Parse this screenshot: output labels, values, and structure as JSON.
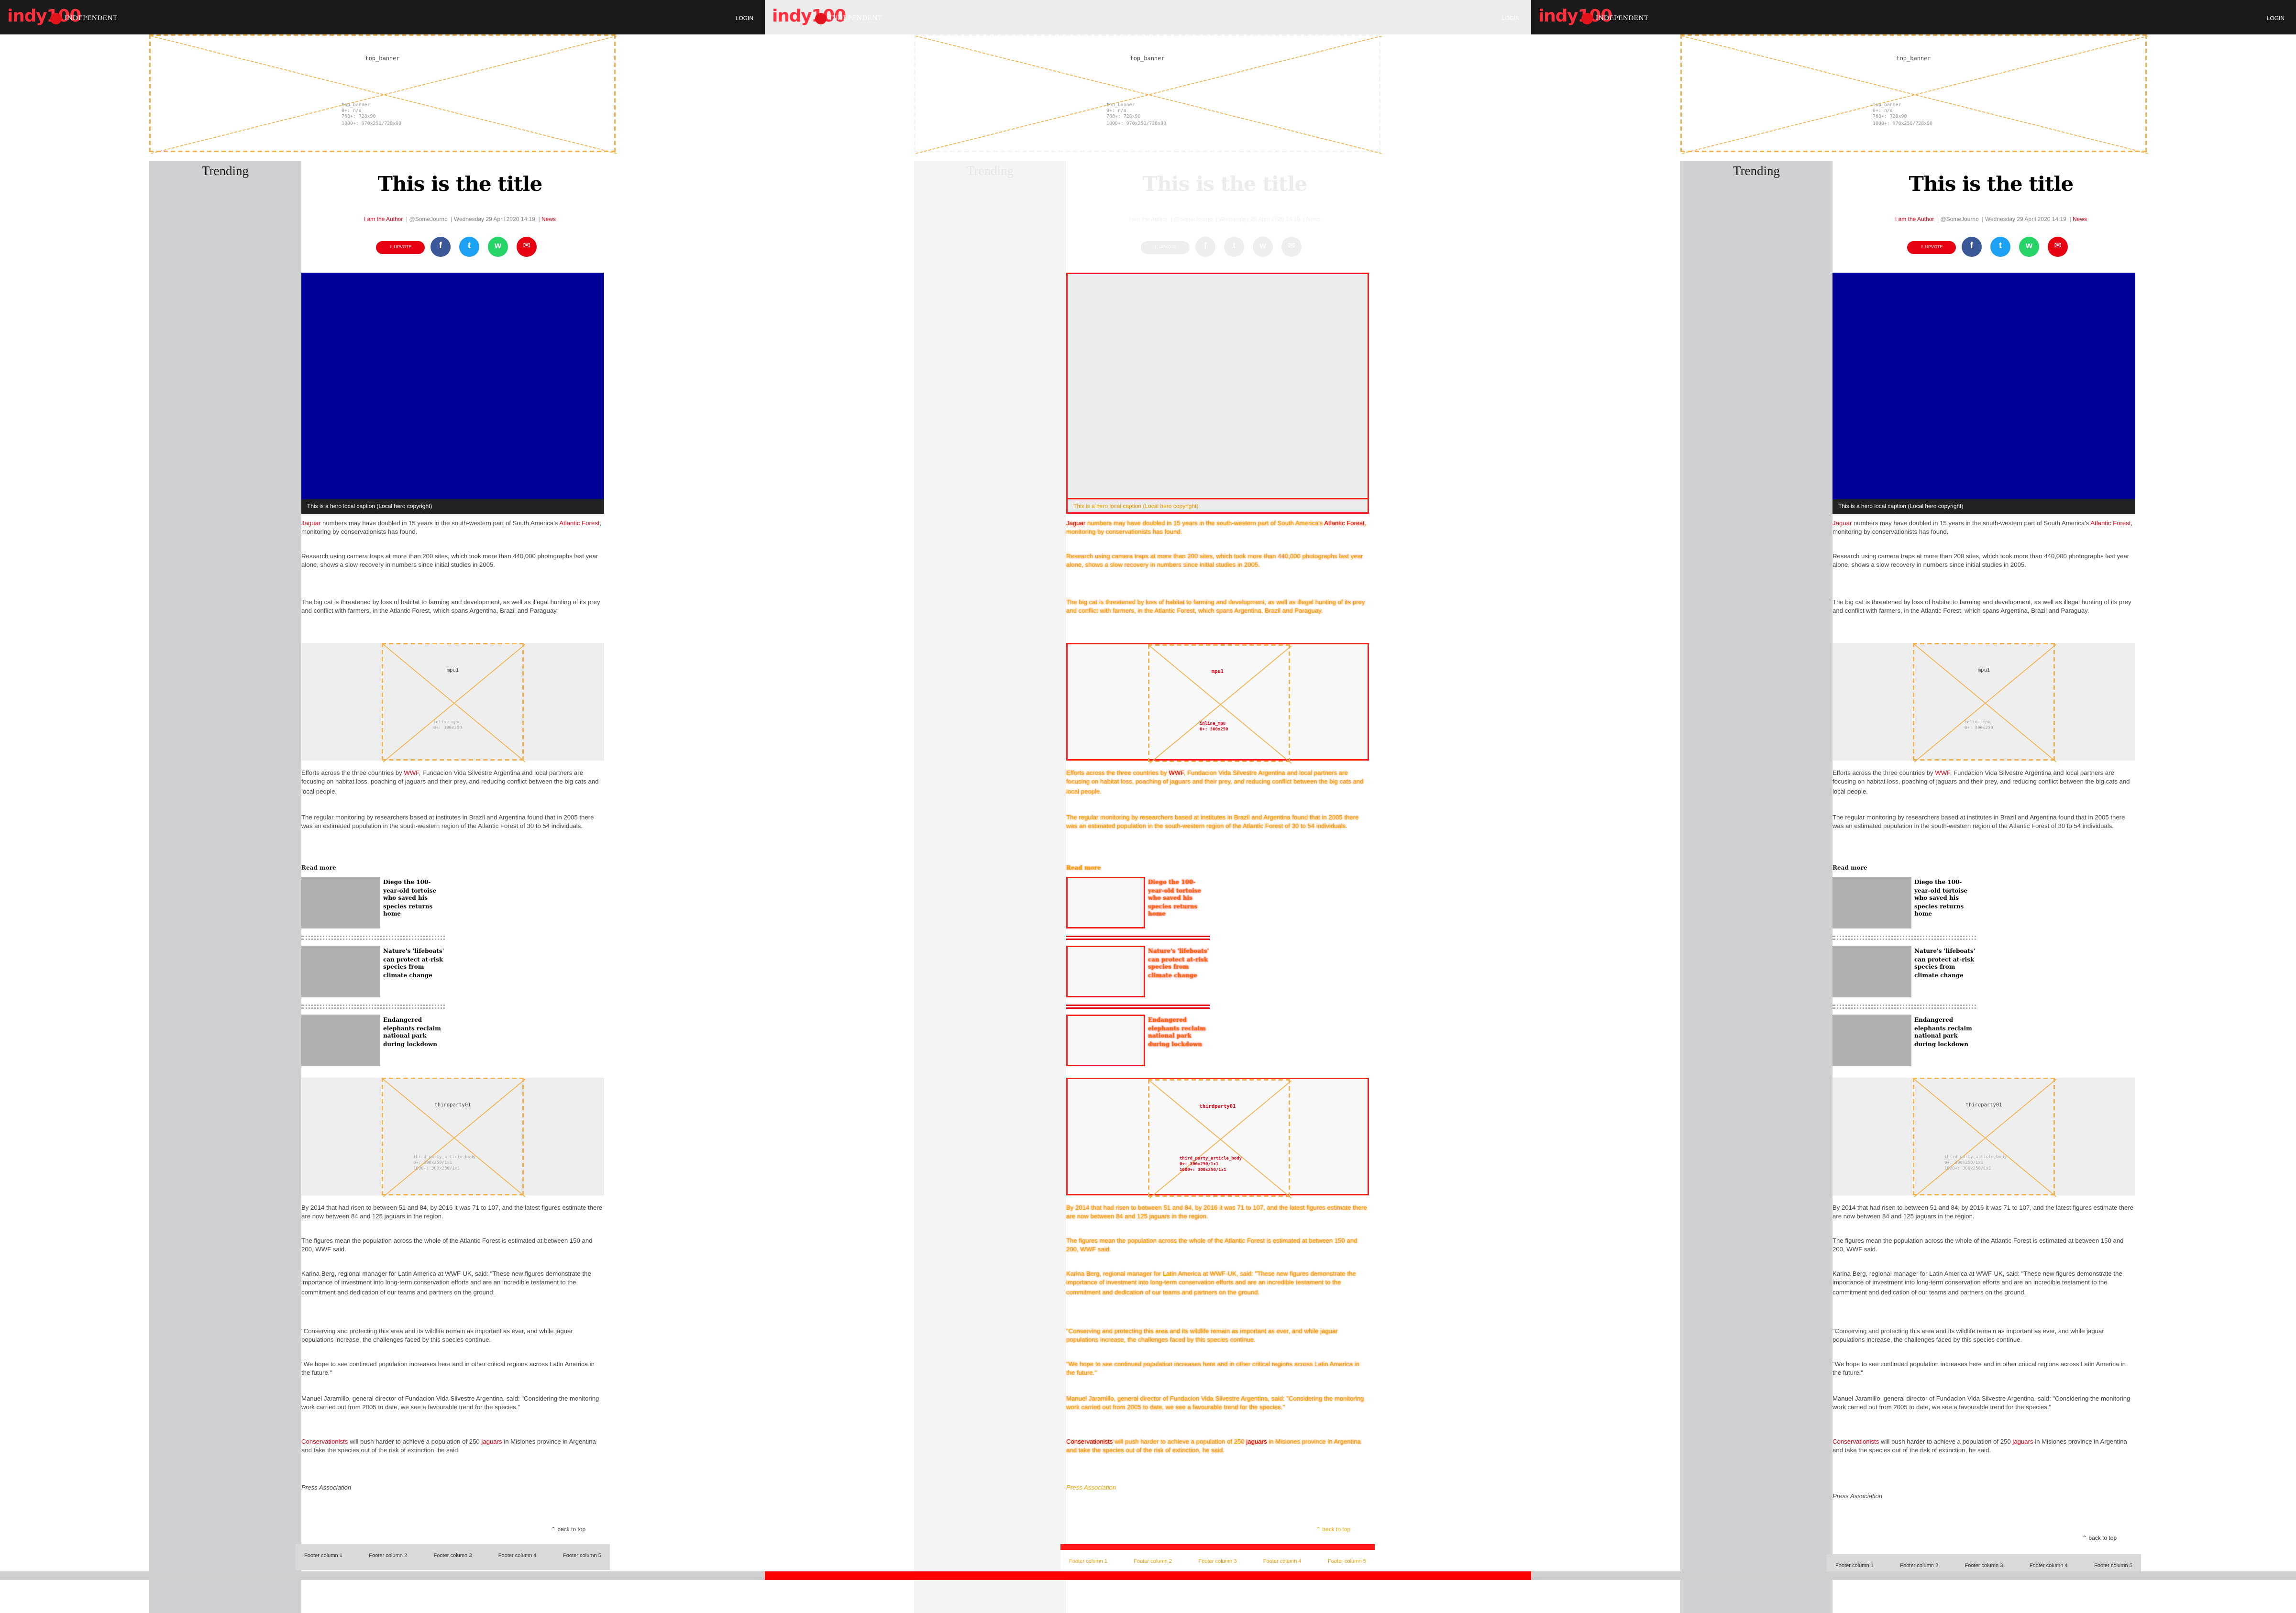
{
  "header": {
    "logo": "indy100",
    "logo_sub": "INDEPENDENT",
    "login_label": "LOGIN"
  },
  "banner": {
    "label": "top_banner",
    "meta": "top_banner\n0+: n/a\n768+: 728x90\n1000+: 970x250/728x90"
  },
  "sidebar": {
    "title": "Trending"
  },
  "article": {
    "title": "This is the title",
    "author": "I am the Author",
    "handle": "@SomeJourno",
    "date": "Wednesday 29 April 2020 14:19",
    "section": "News",
    "upvote_label": "UPVOTE",
    "share_icons": [
      "facebook-icon",
      "twitter-icon",
      "whatsapp-icon",
      "email-icon"
    ],
    "hero_caption": "This is a hero local caption (Local hero copyright)",
    "p1_link1": "Jaguar",
    "p1_text1": " numbers may have doubled in 15 years in the south-western part of South America's ",
    "p1_link2": "Atlantic Forest",
    "p1_text2": ", monitoring by conservationists has found.",
    "p2": "Research using camera traps at more than 200 sites, which took more than 440,000 photographs last year alone, shows a slow recovery in numbers since initial studies in 2005.",
    "p3": "The big cat is threatened by loss of habitat to farming and development, as well as illegal hunting of its prey and conflict with farmers, in the Atlantic Forest, which spans Argentina, Brazil and Paraguay.",
    "ad1_label": "mpu1",
    "ad1_meta": "inline_mpu\n0+: 300x250",
    "p4_text1": "Efforts across the three countries by ",
    "p4_link": "WWF",
    "p4_text2": ", Fundacion Vida Silvestre Argentina and local partners are focusing on habitat loss, poaching of jaguars and their prey, and reducing conflict between the big cats and local people.",
    "p5": "The regular monitoring by researchers based at institutes in Brazil and Argentina found that in 2005 there was an estimated population in the south-western region of the Atlantic Forest of 30 to 54 individuals.",
    "read_more_title": "Read more",
    "read_more": [
      "Diego the 100-year-old tortoise who saved his species returns home",
      "Nature's 'lifeboats' can protect at-risk species from climate change",
      "Endangered elephants reclaim national park during lockdown"
    ],
    "ad2_label": "thirdparty01",
    "ad2_meta": "third_party_article_body\n0+: 300x250/1x1\n1000+: 300x250/1x1",
    "p6": "By 2014 that had risen to between 51 and 84, by 2016 it was 71 to 107, and the latest figures estimate there are now between 84 and 125 jaguars in the region.",
    "p7": "The figures mean the population across the whole of the Atlantic Forest is estimated at between 150 and 200, WWF said.",
    "p8": "Karina Berg, regional manager for Latin America at WWF-UK, said: \"These new figures demonstrate the importance of investment into long-term conservation efforts and are an incredible testament to the commitment and dedication of our teams and partners on the ground.",
    "p9": "\"Conserving and protecting this area and its wildlife remain as important as ever, and while jaguar populations increase, the challenges faced by this species continue.",
    "p10": "\"We hope to see continued population increases here and in other critical regions across Latin America in the future.\"",
    "p11": "Manuel Jaramillo, general director of Fundacion Vida Silvestre Argentina, said: \"Considering the monitoring work carried out from 2005 to date, we see a favourable trend for the species.\"",
    "p12_link1": "Conservationists",
    "p12_text1": " will push harder to achieve a population of 250 ",
    "p12_link2": "jaguars",
    "p12_text2": " in Misiones province in Argentina and take the species out of the risk of extinction, he said.",
    "press": "Press Association",
    "back_to_top": "back to top"
  },
  "footer": {
    "columns": [
      "Footer column 1",
      "Footer column 2",
      "Footer column 3",
      "Footer column 4",
      "Footer column 5"
    ]
  },
  "colors": {
    "brand_red": "#e60012",
    "hero_blue": "#000099",
    "ad_outline": "#f0b34f",
    "diff_red": "#ff1a1a",
    "diff_orange": "#f4a300"
  }
}
